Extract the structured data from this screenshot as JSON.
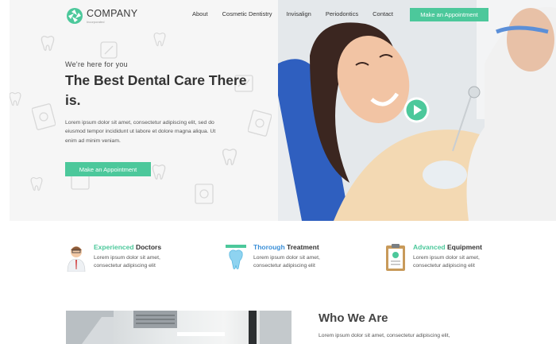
{
  "brand": {
    "name": "COMPANY",
    "tagline": "Incorporated",
    "logo_icon": "aperture-logo-icon",
    "accent_color": "#4cc89b"
  },
  "nav": {
    "items": [
      "About",
      "Cosmetic Dentistry",
      "Invisalign",
      "Periodontics",
      "Contact"
    ],
    "cta_label": "Make an Appointment"
  },
  "hero": {
    "eyebrow": "We're here for you",
    "headline": "The Best Dental Care There is.",
    "lead": "Lorem ipsum dolor sit amet, consectetur adipiscing elit, sed do eiusmod tempor incididunt ut labore et dolore magna aliqua. Ut enim ad minim veniam.",
    "cta_label": "Make an Appointment",
    "video_icon": "play-icon"
  },
  "features": [
    {
      "accent": "Experienced",
      "title": "Doctors",
      "desc": "Lorem ipsum dolor sit amet, consectetur adipiscing elit",
      "icon": "doctor-icon"
    },
    {
      "accent": "Thorough",
      "title": "Treatment",
      "desc": "Lorem ipsum dolor sit amet, consectetur adipiscing elit",
      "icon": "tooth-brush-icon"
    },
    {
      "accent": "Advanced",
      "title": "Equipment",
      "desc": "Lorem ipsum dolor sit amet, consectetur adipiscing elit",
      "icon": "clipboard-icon"
    }
  ],
  "about": {
    "title": "Who We Are",
    "text": "Lorem ipsum dolor sit amet, consectetur adipiscing elit,"
  }
}
